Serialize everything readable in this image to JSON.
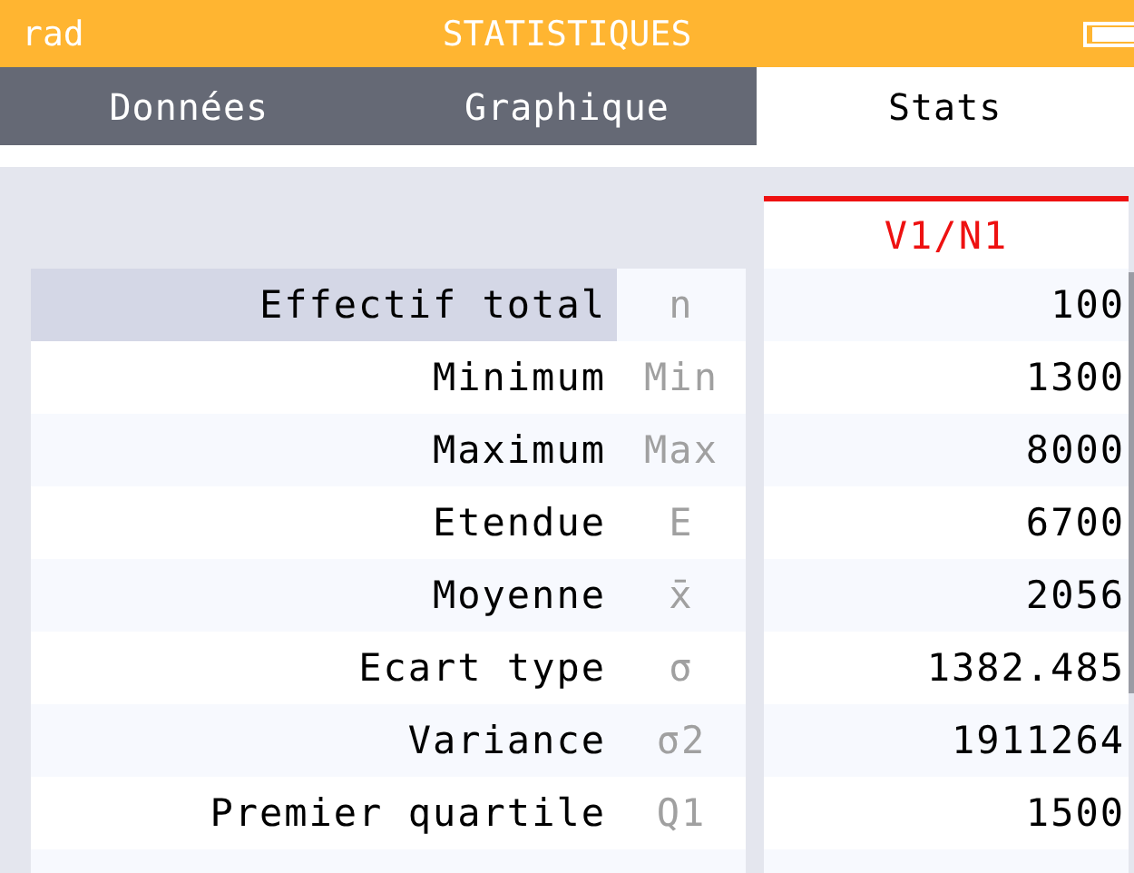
{
  "status_bar": {
    "angle_unit": "rad",
    "title": "STATISTIQUES"
  },
  "tabs": [
    {
      "label": "Données",
      "selected": false
    },
    {
      "label": "Graphique",
      "selected": false
    },
    {
      "label": "Stats",
      "selected": true
    }
  ],
  "table": {
    "columns": [
      {
        "label": "V1/N1"
      }
    ],
    "rows": [
      {
        "label": "Effectif total",
        "symbol": "n",
        "value": "100",
        "selected": true
      },
      {
        "label": "Minimum",
        "symbol": "Min",
        "value": "1300",
        "selected": false
      },
      {
        "label": "Maximum",
        "symbol": "Max",
        "value": "8000",
        "selected": false
      },
      {
        "label": "Etendue",
        "symbol": "E",
        "value": "6700",
        "selected": false
      },
      {
        "label": "Moyenne",
        "symbol": "x̄",
        "value": "2056",
        "selected": false
      },
      {
        "label": "Ecart type",
        "symbol": "σ",
        "value": "1382.485",
        "selected": false
      },
      {
        "label": "Variance",
        "symbol": "σ2",
        "value": "1911264",
        "selected": false
      },
      {
        "label": "Premier quartile",
        "symbol": "Q1",
        "value": "1500",
        "selected": false
      }
    ]
  }
}
